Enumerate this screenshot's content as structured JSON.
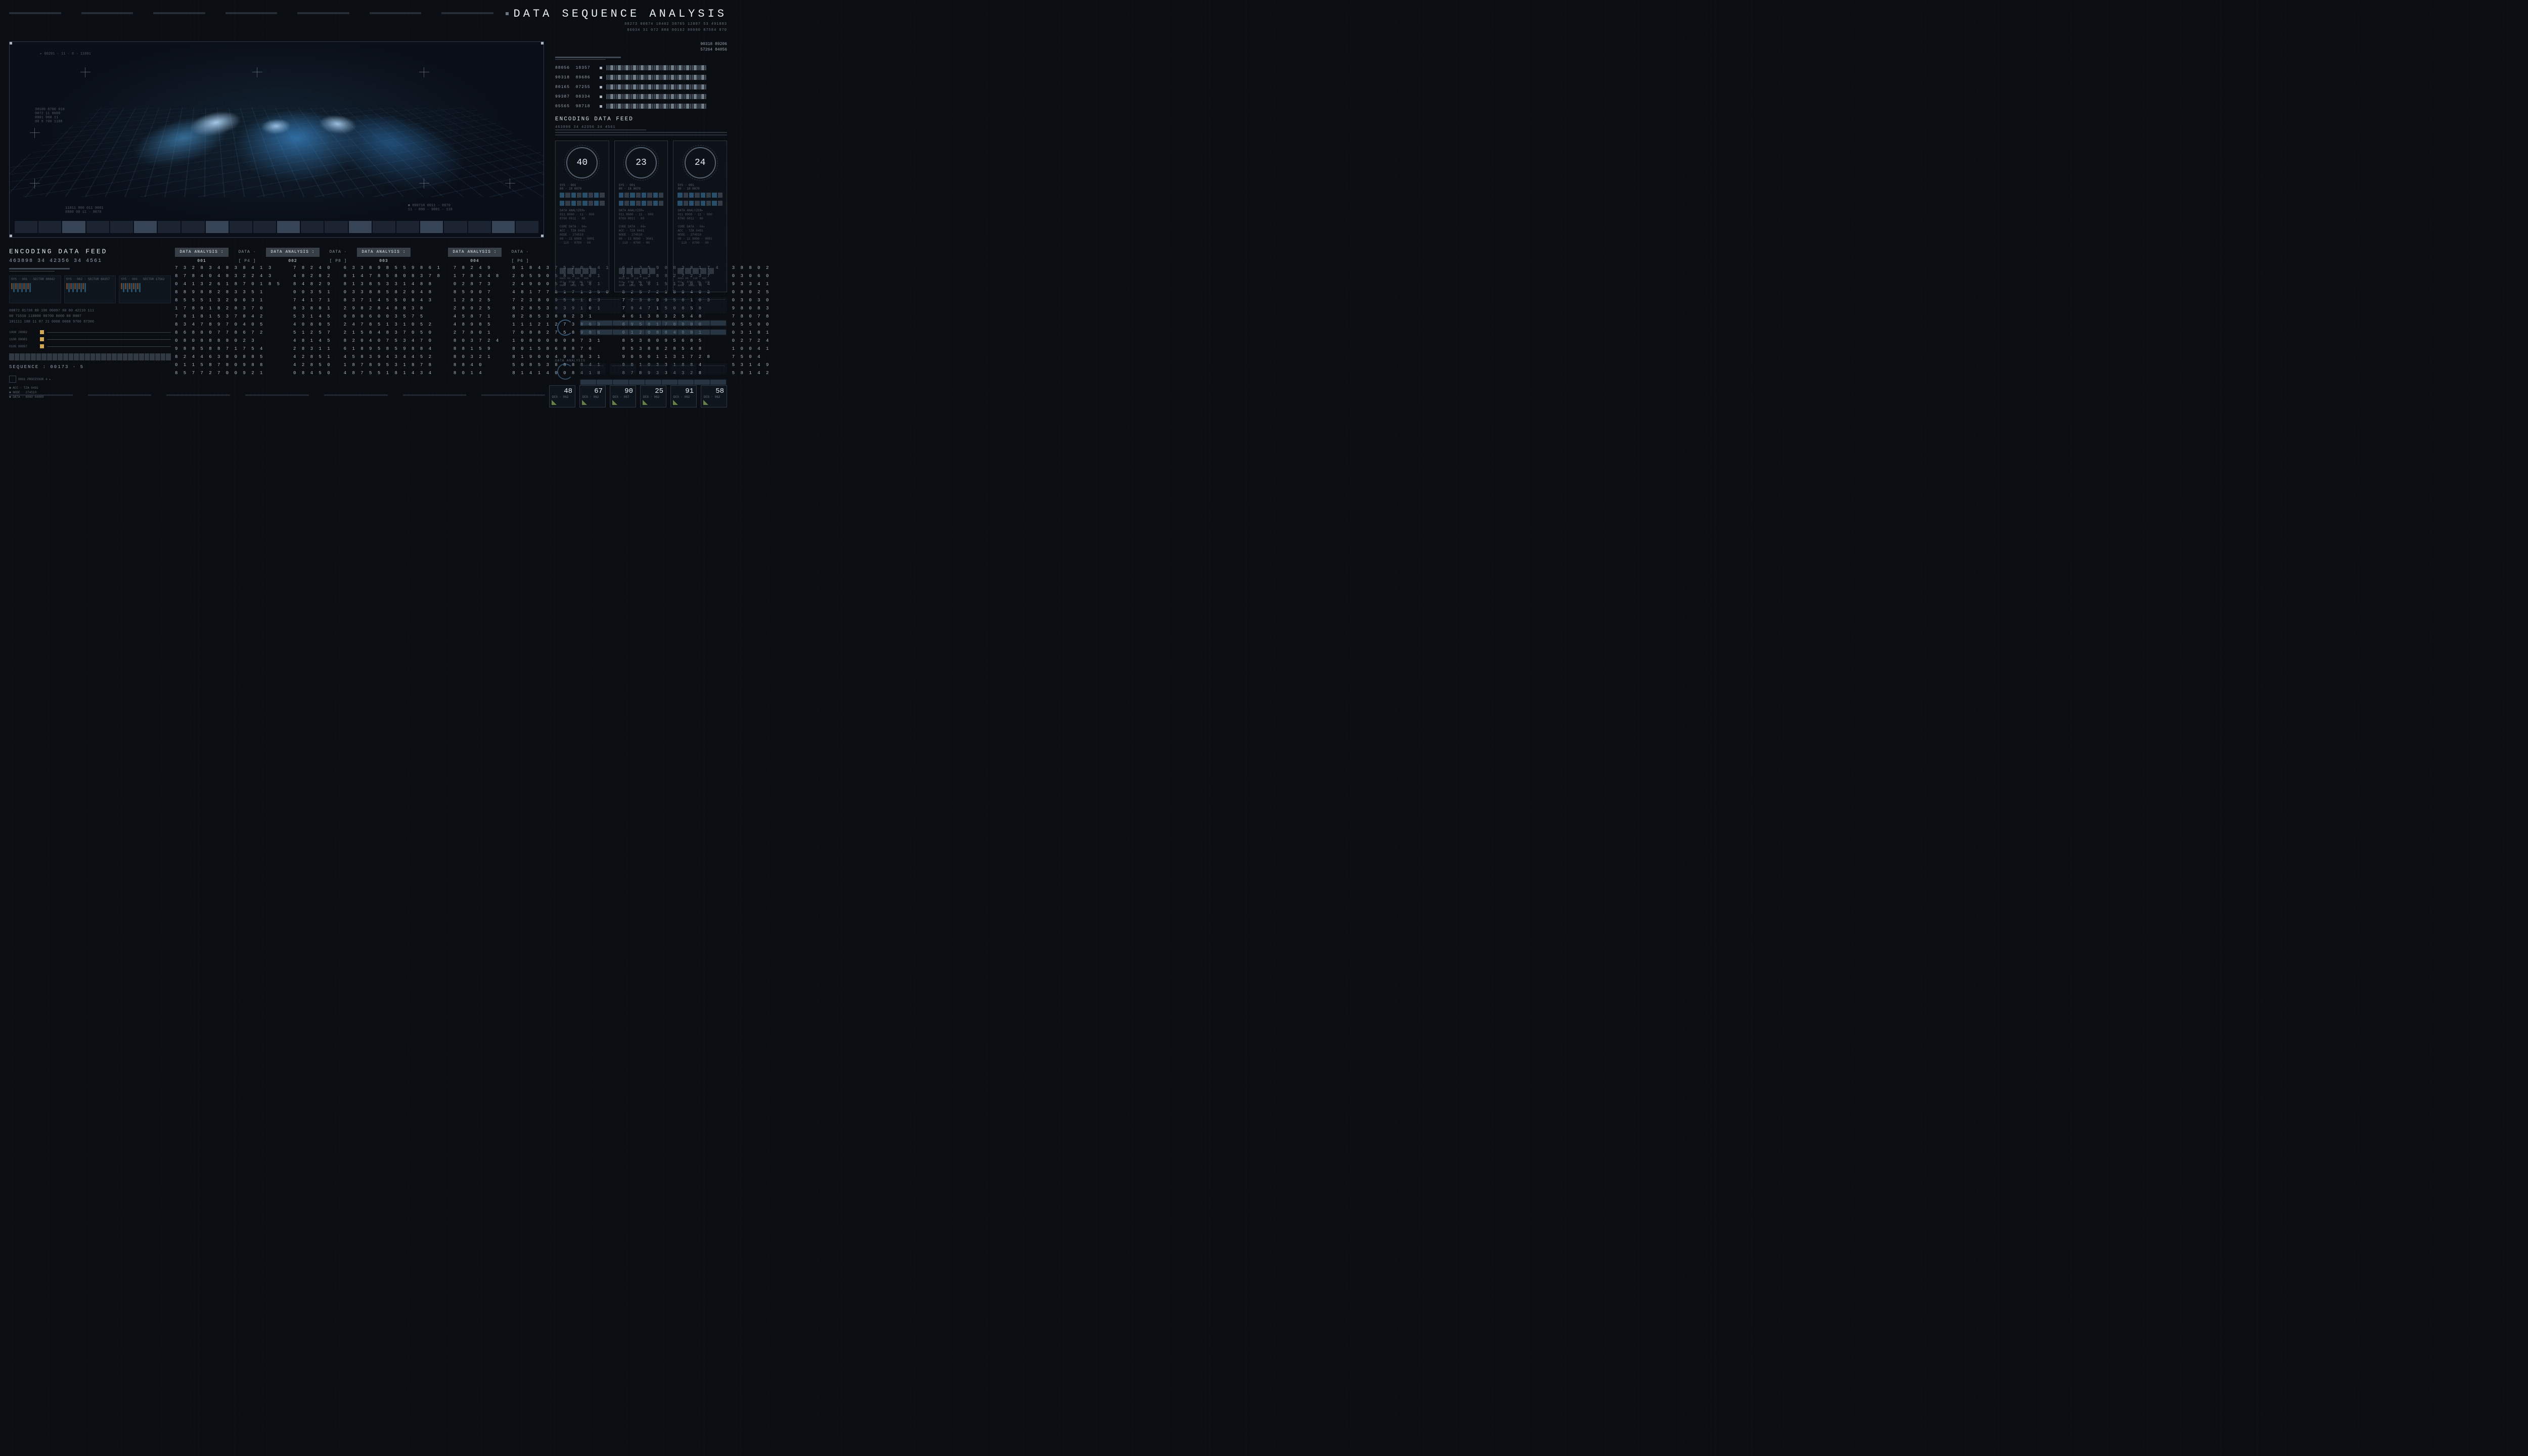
{
  "header": {
    "title": "DATA SEQUENCE ANALYSIS",
    "sub1": "88273 00874 18402 38765 12887 53 491883",
    "sub2": "86034 31 072 880 00162 80080 87584 870"
  },
  "left_panel": {
    "title": "ENCODING DATA FEED",
    "num_strip": "463898  34  42356  34  4561",
    "sys_labels": [
      "SYS · 001 · SECTOR 88042",
      "SYS · 002 · SECTOR 88357",
      "SYS · 003 · SECTOR 17562"
    ],
    "info_lines": "00872 01738 80 196   00097 80   80 42110  111\n00   71510 118000    00700 8000  80  8007\n101111  188  11 87 21   0008  0068 9700 87306",
    "sliders": [
      "1000 28982",
      "1100 80081",
      "0105 80857"
    ],
    "sequence": "SEQUENCE : 00173 · 5",
    "tags": [
      "ACC · TZA 0491",
      "NODE · 274510",
      "DATA · 8080 84089"
    ]
  },
  "data_analysis": {
    "headers": [
      {
        "label": "DATA ANALYSIS : 001",
        "boxed": true
      },
      {
        "label": "DATA · [ P4 ]",
        "boxed": false
      },
      {
        "label": "DATA ANALYSIS : 002",
        "boxed": true
      },
      {
        "label": "DATA · [ P8 ]",
        "boxed": false
      },
      {
        "label": "DATA ANALYSIS : 003",
        "boxed": true
      },
      {
        "label": "",
        "boxed": false
      },
      {
        "label": "DATA ANALYSIS : 004",
        "boxed": true
      },
      {
        "label": "DATA · [ P6 ]",
        "boxed": false
      }
    ],
    "columns": [
      [
        "7 3 2 8 3 4 8 3 8 4 1 3",
        "8 7 8 4 0 4 8 3 2 2 4 3",
        "0 4 1 3 2 6 1 8 7 0 1 8 5",
        "8 8 9 8 8 2 8 3 3 5 1",
        "8 5 5 5 1 3 2 0 0 3 1",
        "1 7 8 9 1 8 2 8 3 7 0",
        "7 8 1 8 1 5 3 7 8 4 2",
        "8 3 4 7 8 9 7 0 4 0 5",
        "8 6 8 8 0 7 7 8 6 7 2",
        "0 8 0 8 8 8 8 0 2 3",
        "9 8 8 5 8 8 7 1 7 5 4",
        "8 2 4 4 6 3 8 0 8 8 5",
        "0 1 1 5 8 7 8 0 9 8 8",
        "8 5 7 7 2 7 0 0 9 2 1"
      ],
      [
        "7 8 2 4 0",
        "4 8 2 8 2",
        "8 4 8 2 9",
        "0 0 3 5 1",
        "7 4 1 7 1",
        "8 3 8 8 1",
        "5 3 1 4 5",
        "4 0 8 0 5",
        "5 1 2 5 7",
        "4 8 1 4 5",
        "2 8 3 1 1",
        "4 2 8 5 1",
        "4 2 8 5 0",
        "0 8 4 5 0"
      ],
      [
        "6 3 3 8 9 8 5 5 9 8 6 1",
        "8 1 4 7 8 5 8 0 8 3 7 8",
        "8 1 3 8 5 3 3 1 4 8 8",
        "0 3 3 8 8 5 8 2 0 4 8",
        "8 3 7 1 4 5 5 0 8 4 3",
        "2 9 8 2 8 4 8 8 3 8",
        "0 8 0 6 0 0 3 5 7 5",
        "2 4 7 8 5 1 3 1 0 5 2",
        "2 1 5 8 4 8 3 7 0 5 0",
        "8 2 0 4 0 7 5 3 4 7 0",
        "6 1 8 9 5 8 5 9 8 8 4",
        "4 5 8 3 9 4 3 4 4 5 2",
        "1 8 7 8 9 5 3 1 8 7 8",
        "4 8 7 5 5 1 8 1 4 3 4"
      ],
      [
        "7 8 2 4 9",
        "1 7 8 3 4 8",
        "0 2 8 7 3",
        "8 5 9 0 7",
        "1 2 8 2 5",
        "2 8 9 2 5",
        "4 5 8 7 1",
        "4 8 9 8 5",
        "2 7 8 0 1",
        "8 0 3 7 2 4",
        "8 8 1 5 9",
        "8 0 3 2 1",
        "8 8 4 0",
        "8 0 1 4"
      ],
      [
        "8 1 8 4 3 7 5 2 0 8 4 1",
        "2 0 5 9 0 5 8 3 8 8 1",
        "2 4 9 0 0 5 8 3 3 8 1",
        "4 8 1 7 7 8 1 7 1 3 5 0",
        "7 2 3 8 0 9 5 8 1 0 3",
        "8 2 8 5 3 8 3 9 1 0 1",
        "8 2 8 5 3 8 8 2 3 1",
        "1 1 1 2 1 2 7 3 8 6 3",
        "7 0 8 8 2 7 5 8 9 8 6",
        "1 0 8 0 0 0 0 8 7 3 1",
        "8 0 1 5 8 6 8 8 7 6",
        "8 1 9 0 0 4 9 8 8 3 1",
        "5 0 8 5 3 8 8 8 8 4 1",
        "8 1 4 1 4 0 0 8 4 1 8"
      ],
      [
        "6 1 3 5 9 0 8 3 8 1 7 4",
        "1 5 1 3 8 8 2 7 2 3 7",
        "7 2 3 8 1 5 1 5 0 0 4",
        "8 2 5 7 2 1 8 0 4 0 3",
        "7 2 3 8 0 9 5 8 1 0 3",
        "7 9 4 7 1 5 0 8 5 8",
        "4 6 1 3 8 3 2 5 4 8",
        "8 9 5 8 1 7 8 8 0 0",
        "0 1 2 0 8 8 4 8 0 1",
        "8 5 3 8 0 9 5 6 8 5",
        "8 5 3 8 8 2 8 5 4 8",
        "9 0 5 0 1 1 3 1 7 2 8",
        "9 0 1 0 3 3 1 8 8 4",
        "8 7 8 9 3 3 4 3 2 8"
      ],
      [
        "3 8 8 0 2",
        "0 3 0 6 0",
        "9 3 3 4 1",
        "0 8 0 2 5",
        "0 3 0 3 0",
        "9 8 0 8 3",
        "7 8 0 7 8",
        "0 5 5 0 0",
        "0 3 1 8 1",
        "0 2 7 2 4",
        "1 0 0 4 1",
        "7 5 0 4",
        "5 3 1 4 9",
        "5 8 1 4 2"
      ]
    ]
  },
  "right": {
    "top_nums": [
      "90318 89206",
      "57264 84056"
    ],
    "tracks": [
      {
        "a": "88056",
        "b": "18357"
      },
      {
        "a": "90318",
        "b": "89686"
      },
      {
        "a": "80165",
        "b": "07255"
      },
      {
        "a": "99387",
        "b": "08334"
      },
      {
        "a": "05565",
        "b": "98718"
      }
    ],
    "encoding_title": "ENCODING DATA FEED",
    "encoding_sub": "463898  34  42356  34  4561",
    "gauges": [
      40,
      23,
      24
    ],
    "analysis_label": "DATA ANALYSIS",
    "tiles": [
      {
        "v": 48,
        "l": "DCS · 062"
      },
      {
        "v": 67,
        "l": "DCS · 062"
      },
      {
        "v": 90,
        "l": "DCS · 067"
      },
      {
        "v": 25,
        "l": "DCS · 062"
      },
      {
        "v": 91,
        "l": "DCS · 062"
      },
      {
        "v": 58,
        "l": "DCS · 062"
      }
    ]
  }
}
